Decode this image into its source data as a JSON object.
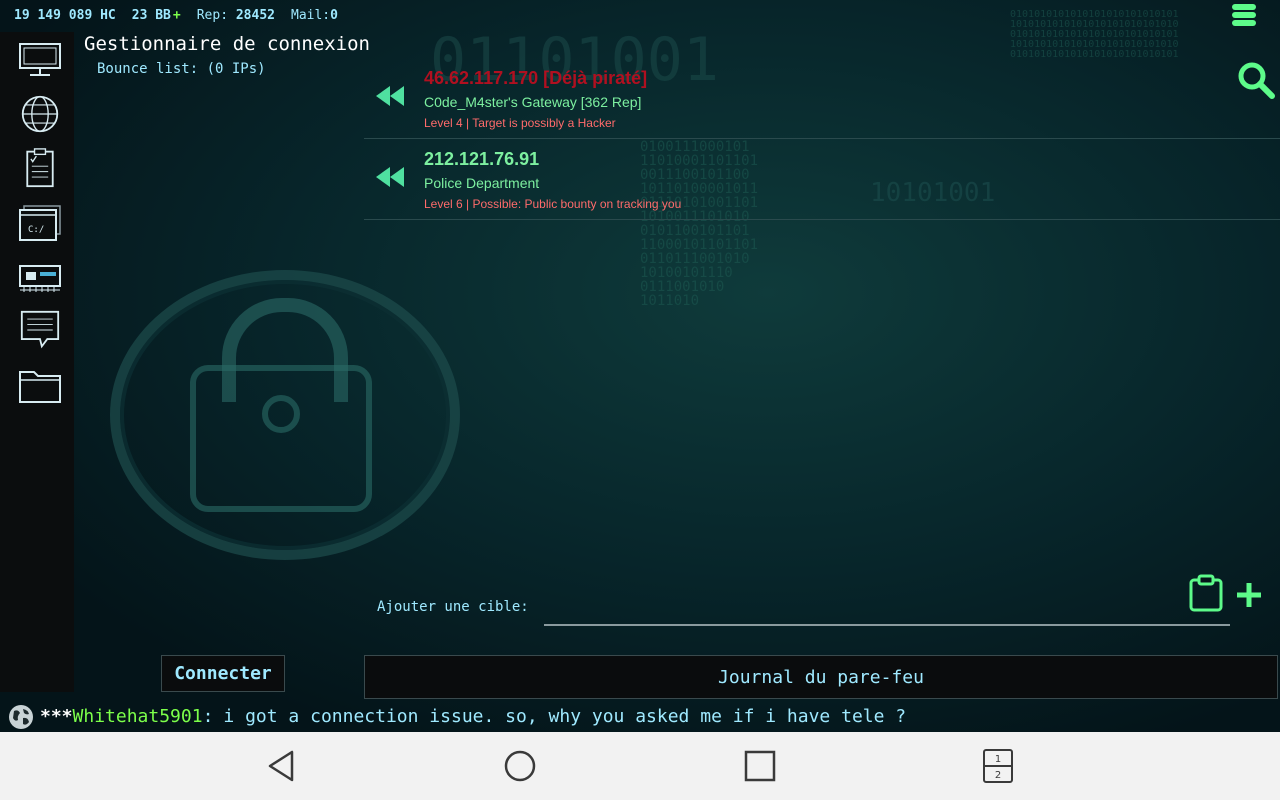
{
  "status": {
    "hc": "19 149 089 HC",
    "bb": "23 BB",
    "bb_plus": "+",
    "rep_label": "Rep:",
    "rep_value": "28452",
    "mail_label": "Mail:",
    "mail_value": "0"
  },
  "header": {
    "title": "Gestionnaire de connexion",
    "bounce_list": "Bounce list: (0 IPs)"
  },
  "connections": [
    {
      "ip": "46.62.117.170 [Déjà piraté]",
      "name": "C0de_M4ster's Gateway [362 Rep]",
      "info": "Level 4 | Target is possibly a Hacker",
      "ip_color": "#b01020"
    },
    {
      "ip": "212.121.76.91",
      "name": "Police Department",
      "info": "Level 6 | Possible: Public bounty on tracking you",
      "ip_color": "#7df0a0"
    }
  ],
  "add_target": {
    "label": "Ajouter une cible:",
    "value": ""
  },
  "buttons": {
    "connect": "Connecter",
    "firewall_log": "Journal du pare-feu"
  },
  "chat": {
    "stars": "***",
    "user": "Whitehat5901",
    "colon": ":",
    "message": "i got a connection issue. so, why you asked me if i have tele ?"
  },
  "sidebar_icons": [
    "monitor-icon",
    "globe-icon",
    "clipboard-icon",
    "terminal-icon",
    "hardware-icon",
    "chat-icon",
    "folder-icon"
  ],
  "navbar": {
    "recents_badge_top": "1",
    "recents_badge_bottom": "2"
  },
  "colors": {
    "accent": "#5dfb8a",
    "text": "#9fe9ff",
    "warning": "#ff6b6b",
    "hacked": "#b01020"
  }
}
